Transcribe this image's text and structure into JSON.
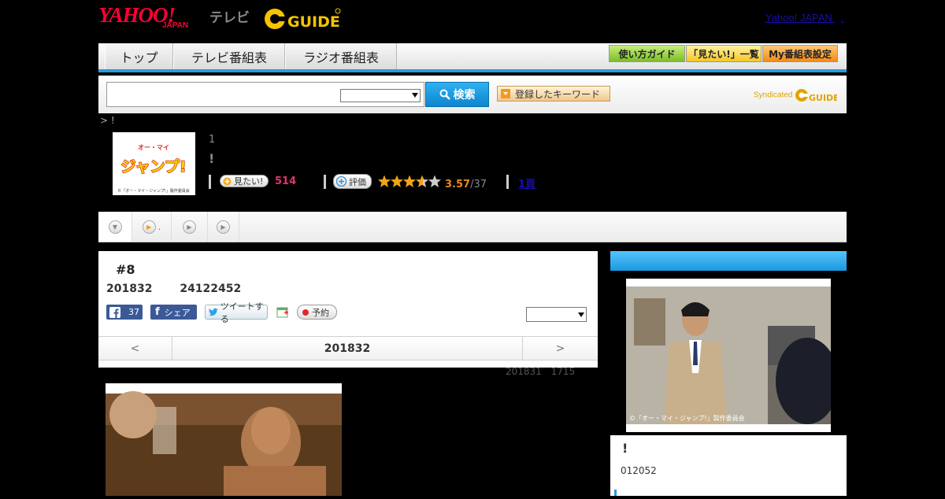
{
  "header": {
    "yahoo_logo": "YAHOO!",
    "yahoo_sub": "JAPAN",
    "tv_label": "テレビ",
    "gguide_logo": "G GUIDE",
    "yj_link": "Yahoo! JAPAN",
    "yj_dot": ","
  },
  "nav": {
    "tabs": [
      "トップ",
      "テレビ番組表",
      "ラジオ番組表"
    ],
    "right_buttons": [
      "使い方ガイド",
      "「見たい!」一覧",
      "My番組表設定"
    ]
  },
  "search": {
    "input_value": "",
    "select_value": "",
    "search_label": "検索",
    "keyword_label": "登録したキーワード",
    "syndicated_label": "Syndicated"
  },
  "breadcrumb": "> !",
  "program": {
    "logo_text": "オー・マイ・ジャンプ!",
    "logo_caption": "©「オー・マイ・ジャンプ!」製作委員会",
    "line1": "1",
    "line2": "!",
    "want_label": "見たい!",
    "want_count": "514",
    "rate_label": "評価",
    "rating": "3.57",
    "rating_count": "/37",
    "link": "1頁"
  },
  "tabs_strip": {
    "second_tab_text": "."
  },
  "episode": {
    "title": "#8",
    "date": "201832 24122452",
    "fb_count": "37",
    "share_label": "シェア",
    "tweet_label": "ツイートする",
    "reserve_label": "予約",
    "select_value": "",
    "prev": "<",
    "current_date": "201832",
    "next": ">"
  },
  "note": "201831 1715",
  "right": {
    "photo_caption": "©「オー・マイ・ジャンプ!」製作委員会",
    "exclaim": "!",
    "code": "012052"
  }
}
